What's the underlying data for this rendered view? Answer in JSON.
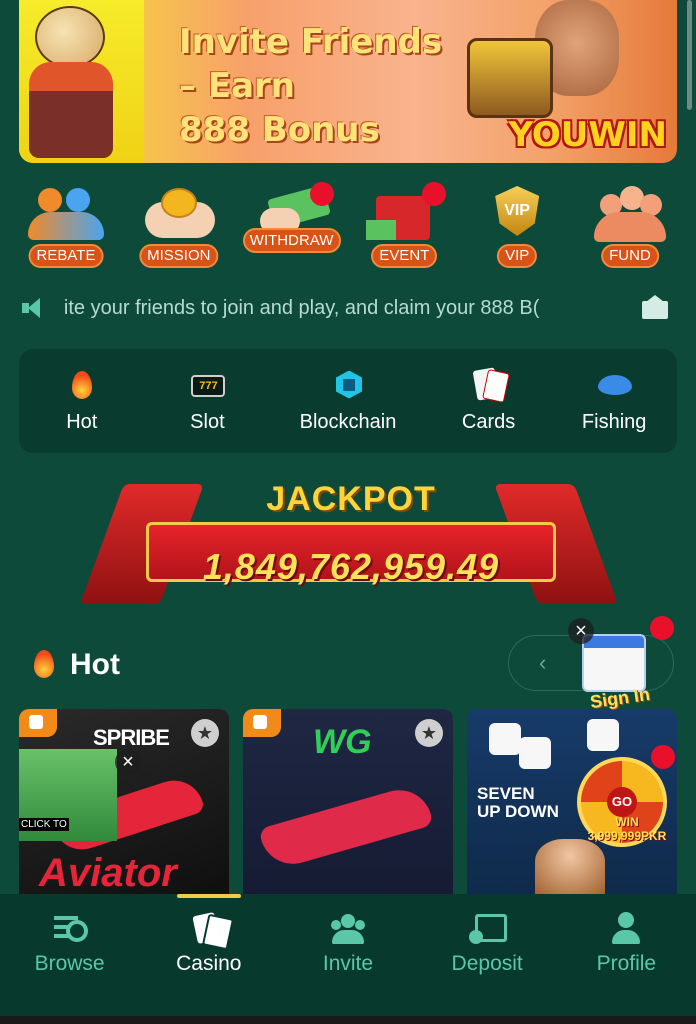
{
  "banner": {
    "title_line1": "Invite Friends",
    "title_line2": "– Earn",
    "title_line3": "888 Bonus",
    "brand": "YOUWIN"
  },
  "quick_actions": [
    {
      "label": "REBATE",
      "icon": "rebate-icon",
      "dot": false
    },
    {
      "label": "MISSION",
      "icon": "mission-icon",
      "dot": false
    },
    {
      "label": "WITHDRAW",
      "icon": "withdraw-icon",
      "dot": true
    },
    {
      "label": "EVENT",
      "icon": "event-icon",
      "dot": true
    },
    {
      "label": "VIP",
      "icon": "vip-icon",
      "dot": false
    },
    {
      "label": "FUND",
      "icon": "fund-icon",
      "dot": false
    }
  ],
  "marquee": {
    "text": "ite your friends to join and play, and claim your 888 B("
  },
  "categories": [
    {
      "label": "Hot",
      "icon": "flame-icon"
    },
    {
      "label": "Slot",
      "icon": "slot-777-icon"
    },
    {
      "label": "Blockchain",
      "icon": "blockchain-cube-icon"
    },
    {
      "label": "Cards",
      "icon": "playing-cards-icon"
    },
    {
      "label": "Fishing",
      "icon": "fish-icon"
    }
  ],
  "jackpot": {
    "label": "JACKPOT",
    "amount": "1,849,762,959.49"
  },
  "hot_section": {
    "title": "Hot"
  },
  "signin_widget": {
    "label": "Sign In"
  },
  "games": [
    {
      "provider": "SPRIBE",
      "title": "Aviator",
      "ad_text": "CLICK TO"
    },
    {
      "provider": "WG",
      "title": ""
    },
    {
      "provider": "",
      "title_line1": "SEVEN",
      "title_line2": "UP DOWN",
      "wheel_center": "GO",
      "win_label": "WIN",
      "win_amount": "3,999,999PKR"
    }
  ],
  "bottom_nav": [
    {
      "label": "Browse",
      "icon": "browse-search-icon",
      "active": false
    },
    {
      "label": "Casino",
      "icon": "casino-cards-icon",
      "active": true
    },
    {
      "label": "Invite",
      "icon": "invite-people-icon",
      "active": false
    },
    {
      "label": "Deposit",
      "icon": "deposit-wallet-icon",
      "active": false
    },
    {
      "label": "Profile",
      "icon": "profile-user-icon",
      "active": false
    }
  ],
  "colors": {
    "background": "#0d4a3a",
    "accent_orange": "#d85317",
    "notification_red": "#e8102a",
    "nav_inactive": "#5ac8a8",
    "jackpot_red": "#e8232a",
    "jackpot_gold": "#ffd438"
  }
}
